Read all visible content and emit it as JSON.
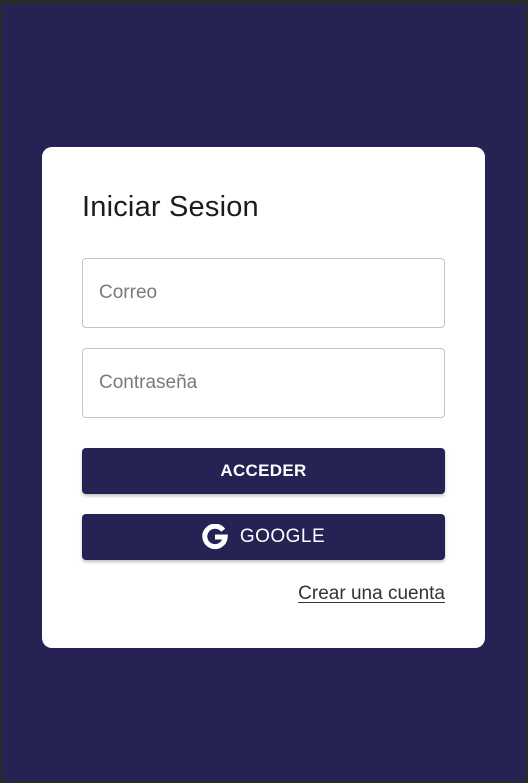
{
  "login": {
    "title": "Iniciar Sesion",
    "email_placeholder": "Correo",
    "password_placeholder": "Contraseña",
    "submit_label": "ACCEDER",
    "google_label": "GOOGLE",
    "create_account_label": "Crear una cuenta"
  },
  "colors": {
    "background": "#262254",
    "button": "#262254",
    "card": "#ffffff"
  },
  "icons": {
    "google": "google-g-icon"
  }
}
